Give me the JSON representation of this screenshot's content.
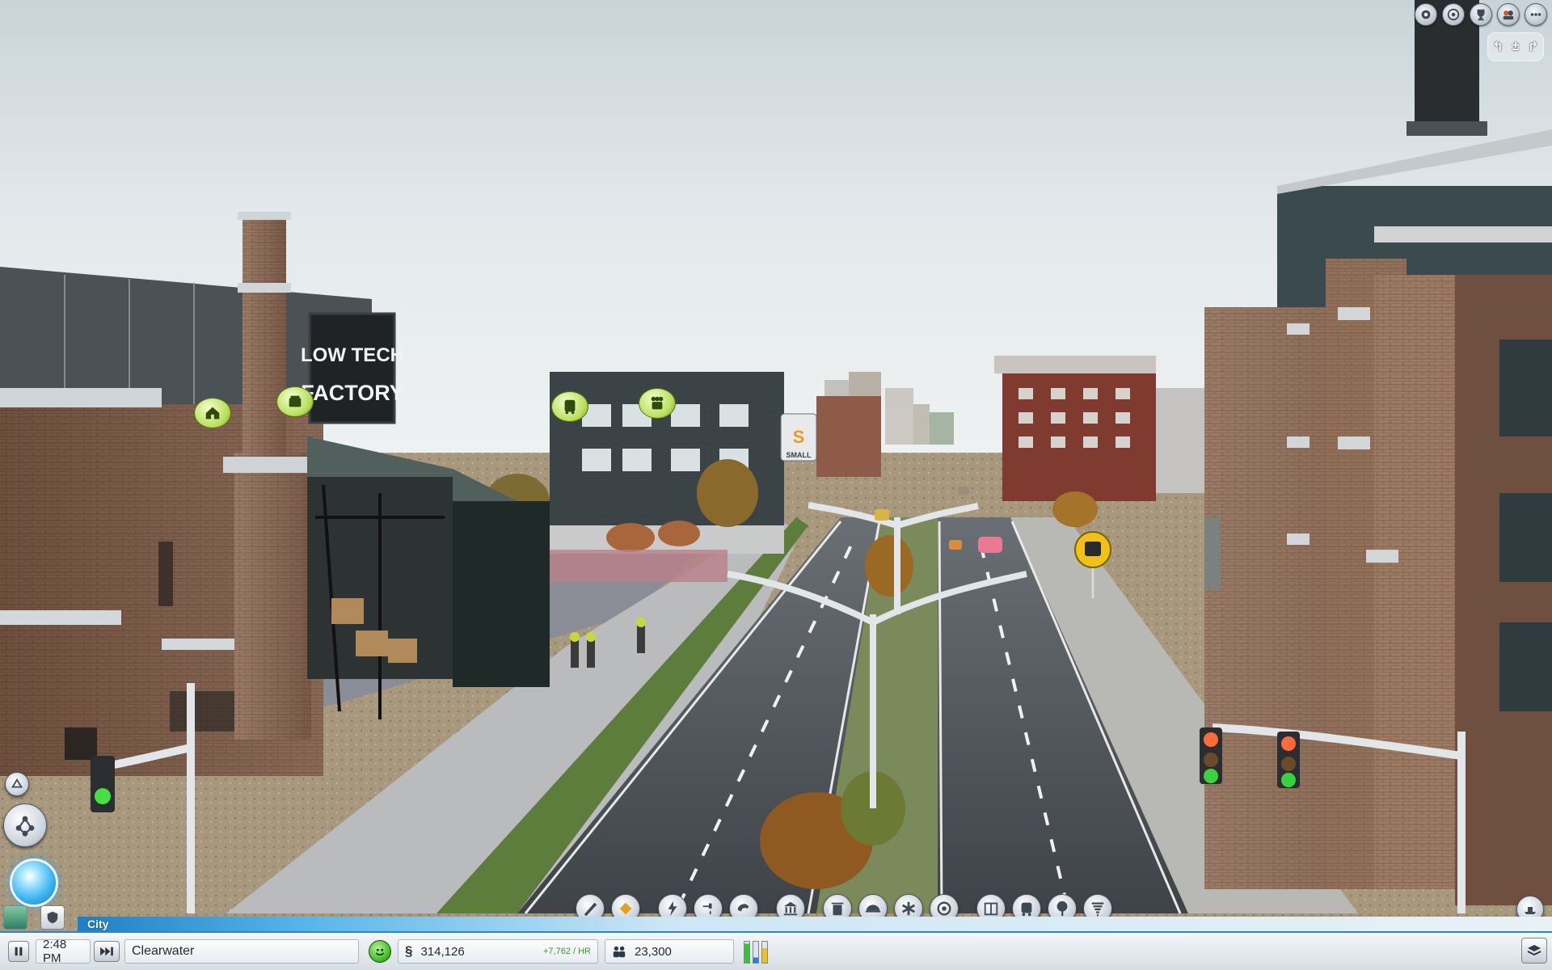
{
  "scene": {
    "factory_sign": [
      "LOW TECH",
      "FACTORY"
    ],
    "small_business_sign": "SMALL"
  },
  "hud": {
    "panel_label": "City",
    "clock": "2:48 PM",
    "city_name": "Clearwater",
    "funds": "314,126",
    "income_rate": "+7,762 / HR",
    "population": "23,300",
    "currency_symbol": "§",
    "mood_icon": "happy-face-icon",
    "rci_colors": {
      "residential": "#39c13a",
      "commercial": "#2d7fd6",
      "industrial": "#f1c215"
    },
    "rci_levels": {
      "residential": 0.9,
      "commercial": 0.25,
      "industrial": 0.7
    }
  },
  "top_right": {
    "buttons": [
      "achievements-icon",
      "regions-icon",
      "trophy-icon",
      "friends-icon",
      "more-options-icon"
    ],
    "camera": [
      "rotate-left",
      "zoom",
      "rotate-right"
    ]
  },
  "toolbar_tools": [
    "road-tool-icon",
    "zoning-tool-icon",
    "power-tool-icon",
    "water-tool-icon",
    "sewage-tool-icon",
    "city-hall-icon",
    "garbage-icon",
    "fire-dept-icon",
    "health-icon",
    "police-icon",
    "education-icon",
    "transportation-icon",
    "parks-icon",
    "disasters-icon"
  ],
  "colors": {
    "accent": "#2e86c6",
    "sky_top": "#d9e2e6",
    "bubble": "#b8df5a"
  }
}
